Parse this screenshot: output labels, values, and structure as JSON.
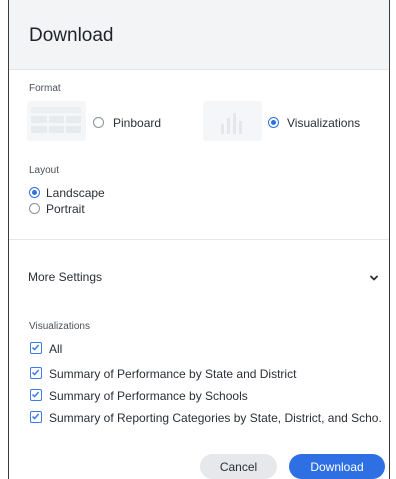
{
  "dialog": {
    "title": "Download"
  },
  "format": {
    "label": "Format",
    "options": [
      {
        "label": "Pinboard",
        "selected": false
      },
      {
        "label": "Visualizations",
        "selected": true
      }
    ]
  },
  "layout": {
    "label": "Layout",
    "options": [
      {
        "label": "Landscape",
        "selected": true
      },
      {
        "label": "Portrait",
        "selected": false
      }
    ]
  },
  "more_settings": {
    "label": "More Settings",
    "icon": "chevron-down-icon"
  },
  "visualizations": {
    "label": "Visualizations",
    "all_label": "All",
    "all_checked": true,
    "items": [
      {
        "label": "Summary of Performance by State and District",
        "checked": true
      },
      {
        "label": "Summary of Performance by Schools",
        "checked": true
      },
      {
        "label": "Summary of Reporting Categories by State, District, and Scho...",
        "checked": true
      }
    ]
  },
  "actions": {
    "cancel": "Cancel",
    "download": "Download"
  },
  "colors": {
    "accent": "#2f6fe4",
    "header_bg": "#f3f4f6",
    "checkbox": "#3b7be8"
  }
}
